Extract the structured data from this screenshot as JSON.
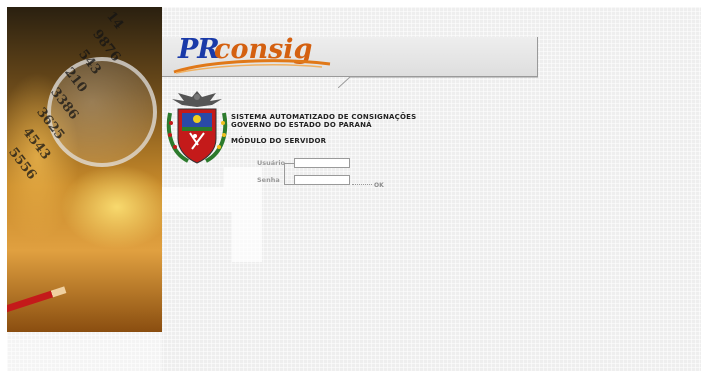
{
  "brand": {
    "logo_prefix": "PR",
    "logo_suffix": "consig",
    "prefix_color": "#1a3aa8",
    "suffix_color": "#d46010"
  },
  "titles": {
    "system_name": "SISTEMA AUTOMATIZADO DE CONSIGNAÇÕES",
    "government": "GOVERNO DO ESTADO DO PARANÁ",
    "module": "MÓDULO DO SERVIDOR"
  },
  "login_form": {
    "user_label": "Usuário",
    "user_value": "",
    "password_label": "Senha",
    "password_value": "",
    "submit_label": "OK"
  },
  "decor": {
    "side_photo_numbers": [
      "14",
      "9876",
      "543",
      "210",
      "3386",
      "3625",
      "4543",
      "5556"
    ]
  }
}
